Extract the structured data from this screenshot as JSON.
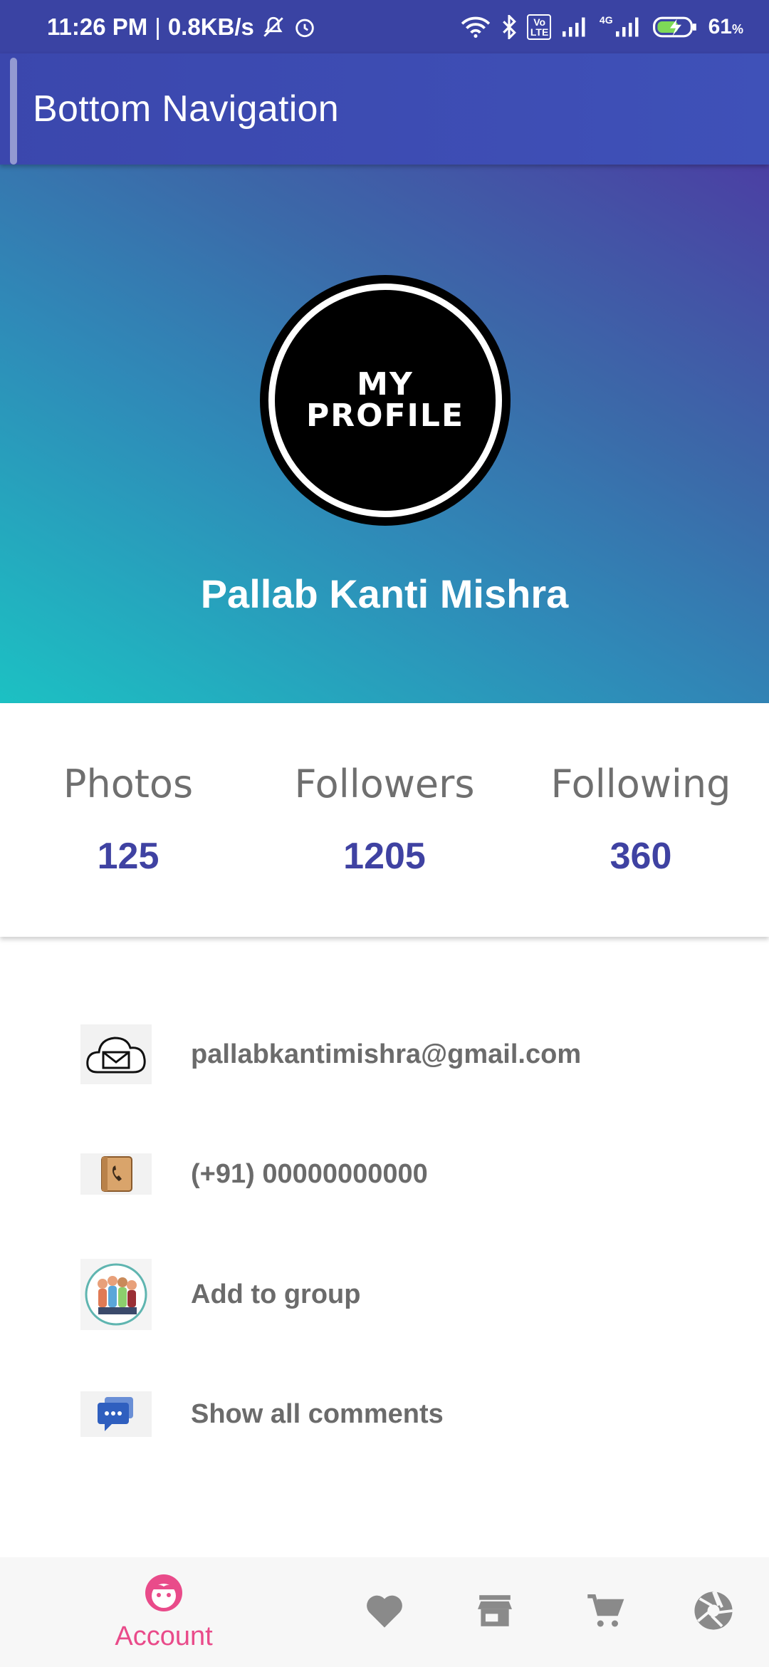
{
  "status_bar": {
    "time": "11:26 PM",
    "speed": "0.8KB/s",
    "battery": "61",
    "battery_unit": "%",
    "network": "4G",
    "volte": "Vo LTE"
  },
  "app_bar": {
    "title": "Bottom Navigation"
  },
  "profile": {
    "avatar_line1": "MY",
    "avatar_line2": "PROFILE",
    "name": "Pallab Kanti Mishra"
  },
  "stats": [
    {
      "label": "Photos",
      "value": "125"
    },
    {
      "label": "Followers",
      "value": "1205"
    },
    {
      "label": "Following",
      "value": "360"
    }
  ],
  "info": {
    "email": "pallabkantimishra@gmail.com",
    "phone": "(+91) 00000000000",
    "group": "Add to group",
    "comments": "Show all comments"
  },
  "bottom_nav": {
    "active_label": "Account",
    "items": [
      "account-icon",
      "heart-icon",
      "store-icon",
      "cart-icon",
      "aperture-icon"
    ],
    "active_color": "#e94b8a",
    "inactive_color": "#8a8a8a"
  }
}
